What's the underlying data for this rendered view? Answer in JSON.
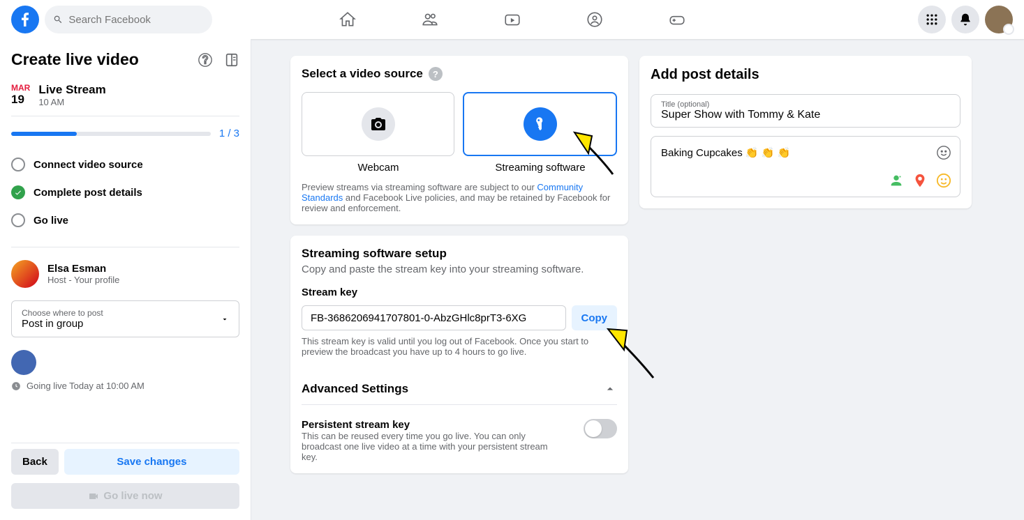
{
  "topbar": {
    "search_placeholder": "Search Facebook"
  },
  "sidebar": {
    "title": "Create live video",
    "date": {
      "month": "MAR",
      "day": "19"
    },
    "event_title": "Live Stream",
    "event_time": "10 AM",
    "progress_text": "1 / 3",
    "steps": {
      "connect": "Connect video source",
      "complete": "Complete post details",
      "golive": "Go live"
    },
    "user": {
      "name": "Elsa Esman",
      "role": "Host - Your profile"
    },
    "post_destination": {
      "label": "Choose where to post",
      "value": "Post in group"
    },
    "going_live_text": "Going live Today at 10:00 AM",
    "buttons": {
      "back": "Back",
      "save": "Save changes",
      "golive_now": "Go live now"
    }
  },
  "source_card": {
    "title": "Select a video source",
    "webcam_label": "Webcam",
    "streaming_label": "Streaming software",
    "fine_text_1": "Preview streams via streaming software are subject to our ",
    "fine_text_link": "Community Standards",
    "fine_text_2": " and Facebook Live policies, and may be retained by Facebook for review and enforcement."
  },
  "setup_card": {
    "title": "Streaming software setup",
    "subtitle": "Copy and paste the stream key into your streaming software.",
    "stream_key_label": "Stream key",
    "stream_key_value": "FB-3686206941707801-0-AbzGHlc8prT3-6XG",
    "copy_label": "Copy",
    "key_note": "This stream key is valid until you log out of Facebook. Once you start to preview the broadcast you have up to 4 hours to go live.",
    "advanced_title": "Advanced Settings",
    "persistent_title": "Persistent stream key",
    "persistent_desc": "This can be reused every time you go live. You can only broadcast one live video at a time with your persistent stream key."
  },
  "post_details": {
    "title": "Add post details",
    "title_field_label": "Title (optional)",
    "title_field_value": "Super Show with Tommy & Kate",
    "description": "Baking Cupcakes 👏 👏 👏"
  }
}
